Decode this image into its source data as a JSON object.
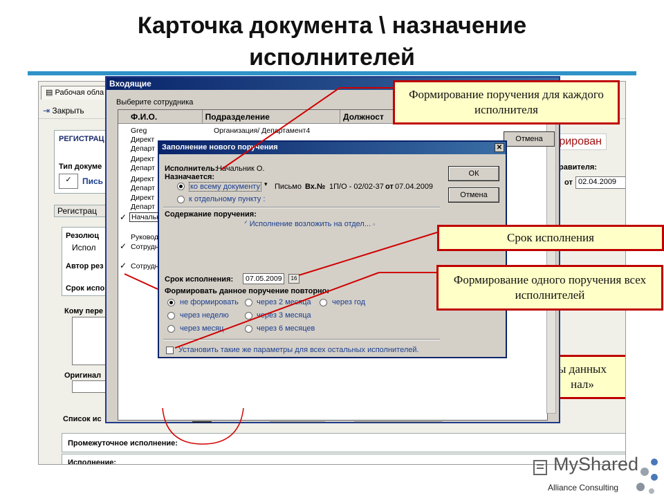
{
  "slide": {
    "title_line1": "Карточка документа \\ назначение",
    "title_line2": "исполнителей",
    "footer_credit": "Alliance Consulting",
    "logo_text": "MyShared"
  },
  "bg_app": {
    "tab_label": "Рабочая обла",
    "close_label": "Закрыть",
    "reg_label": "РЕГИСТРАЦ",
    "doc_type_label": "Тип докуме",
    "letter_label": "Пись",
    "status_text": "стрирован",
    "reg_tab_label": "Регистрац",
    "resolution_label": "Резолюц",
    "resolution_value": "Испол",
    "author_label": "Автор рез",
    "deadline_label": "Срок испо",
    "to_whom_label": "Кому пере",
    "original_label": "Оригинал",
    "list_label": "Список ис",
    "intermediate_label": "Промежуточное исполнение:",
    "execution_label": "Исполнение:",
    "executor_col_label": "равителя:",
    "date_prefix": "от",
    "date_value": "02.04.2009",
    "callout_partial_line1": "ы данных",
    "callout_partial_line2": "нал»"
  },
  "window": {
    "title": "Входящие",
    "subtitle": "Выберите сотрудника",
    "cancel_label": "Отмена",
    "columns": [
      "Ф.И.О.",
      "Подразделение",
      "Должност"
    ],
    "rows": [
      {
        "name": "Greg",
        "dept": "Организация/ Департамент4"
      },
      {
        "name": "Директ",
        "dept": ""
      },
      {
        "name": "Департ",
        "dept": ""
      },
      {
        "name": "Директ",
        "dept": ""
      },
      {
        "name": "Департ",
        "dept": ""
      },
      {
        "name": "Директ",
        "dept": ""
      },
      {
        "name": "Департ",
        "dept": ""
      },
      {
        "name": "Директ",
        "dept": ""
      },
      {
        "name": "Департ",
        "dept": ""
      },
      {
        "name": "Начальн",
        "dept": ""
      },
      {
        "name": "Руковод",
        "dept": ""
      },
      {
        "name": "Сотрудн",
        "dept": ""
      },
      {
        "name": "Сотрудн",
        "dept": ""
      }
    ]
  },
  "dialog": {
    "title": "Заполнение нового поручения",
    "executor_label": "Исполнитель:",
    "executor_value": "Начальник О.",
    "assigned_label": "Назначается:",
    "option_whole_doc": "ко всему документу",
    "option_item": "к отдельному пункту :",
    "letter_text": "Письмо",
    "letter_num_label": "Вх.№",
    "letter_num": "1П/О - 02/02-37",
    "letter_from": "от",
    "letter_date": "07.04.2009",
    "content_label": "Содержание поручения:",
    "content_value": "Исполнение возложить на отдел...",
    "deadline_label": "Срок исполнения:",
    "deadline_value": "07.05.2009",
    "calendar_icon_text": "16",
    "repeat_label": "Формировать данное поручение повторно:",
    "repeat_options": [
      "не формировать",
      "через 2 месяца",
      "через год",
      "через неделю",
      "через 3 месяца",
      "через месяц",
      "через 6 месяцев"
    ],
    "apply_all_label": "Установить такие же параметры для всех остальных исполнителей.",
    "ok_label": "ОК",
    "cancel_label": "Отмена"
  },
  "callouts": {
    "per_executor": "Формирование поручения для каждого исполнителя",
    "deadline": "Срок исполнения",
    "single_for_all": "Формирование одного поручения всех исполнителей"
  },
  "colors": {
    "accent_bar": "#2f93c8",
    "callout_border": "#c00000",
    "callout_fill": "#ffffc8",
    "titlebar": "#0a246a"
  }
}
